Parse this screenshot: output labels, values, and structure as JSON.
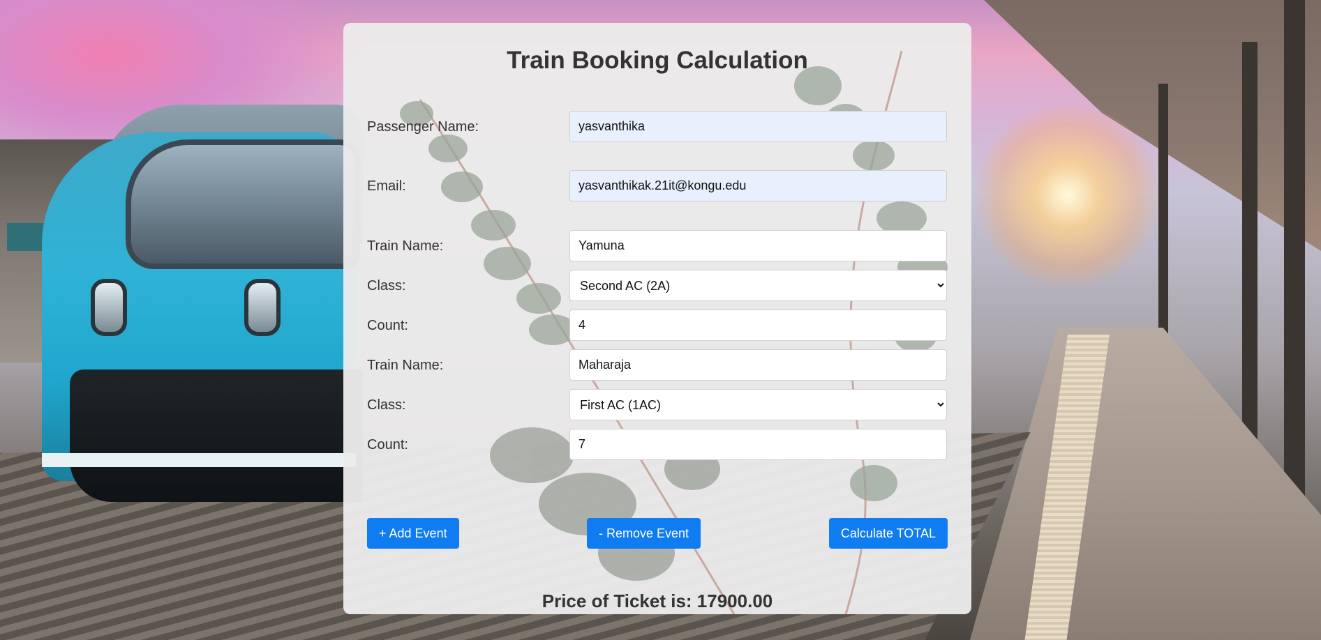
{
  "title": "Train Booking Calculation",
  "form": {
    "passenger_name": {
      "label": "Passenger Name:",
      "value": "yasvanthika"
    },
    "email": {
      "label": "Email:",
      "value": "yasvanthikak.21it@kongu.edu"
    },
    "events": [
      {
        "train_label": "Train Name:",
        "train_value": "Yamuna",
        "class_label": "Class:",
        "class_value": "Second AC (2A)",
        "count_label": "Count:",
        "count_value": "4"
      },
      {
        "train_label": "Train Name:",
        "train_value": "Maharaja",
        "class_label": "Class:",
        "class_value": "First AC (1AC)",
        "count_label": "Count:",
        "count_value": "7"
      }
    ]
  },
  "buttons": {
    "add": "+ Add Event",
    "remove": "- Remove Event",
    "calculate": "Calculate TOTAL"
  },
  "result": "Price of Ticket is: 17900.00",
  "colors": {
    "button": "#0f7cf2",
    "card": "#ecebeb",
    "text": "#333333",
    "autofill": "#e8f0fe"
  }
}
